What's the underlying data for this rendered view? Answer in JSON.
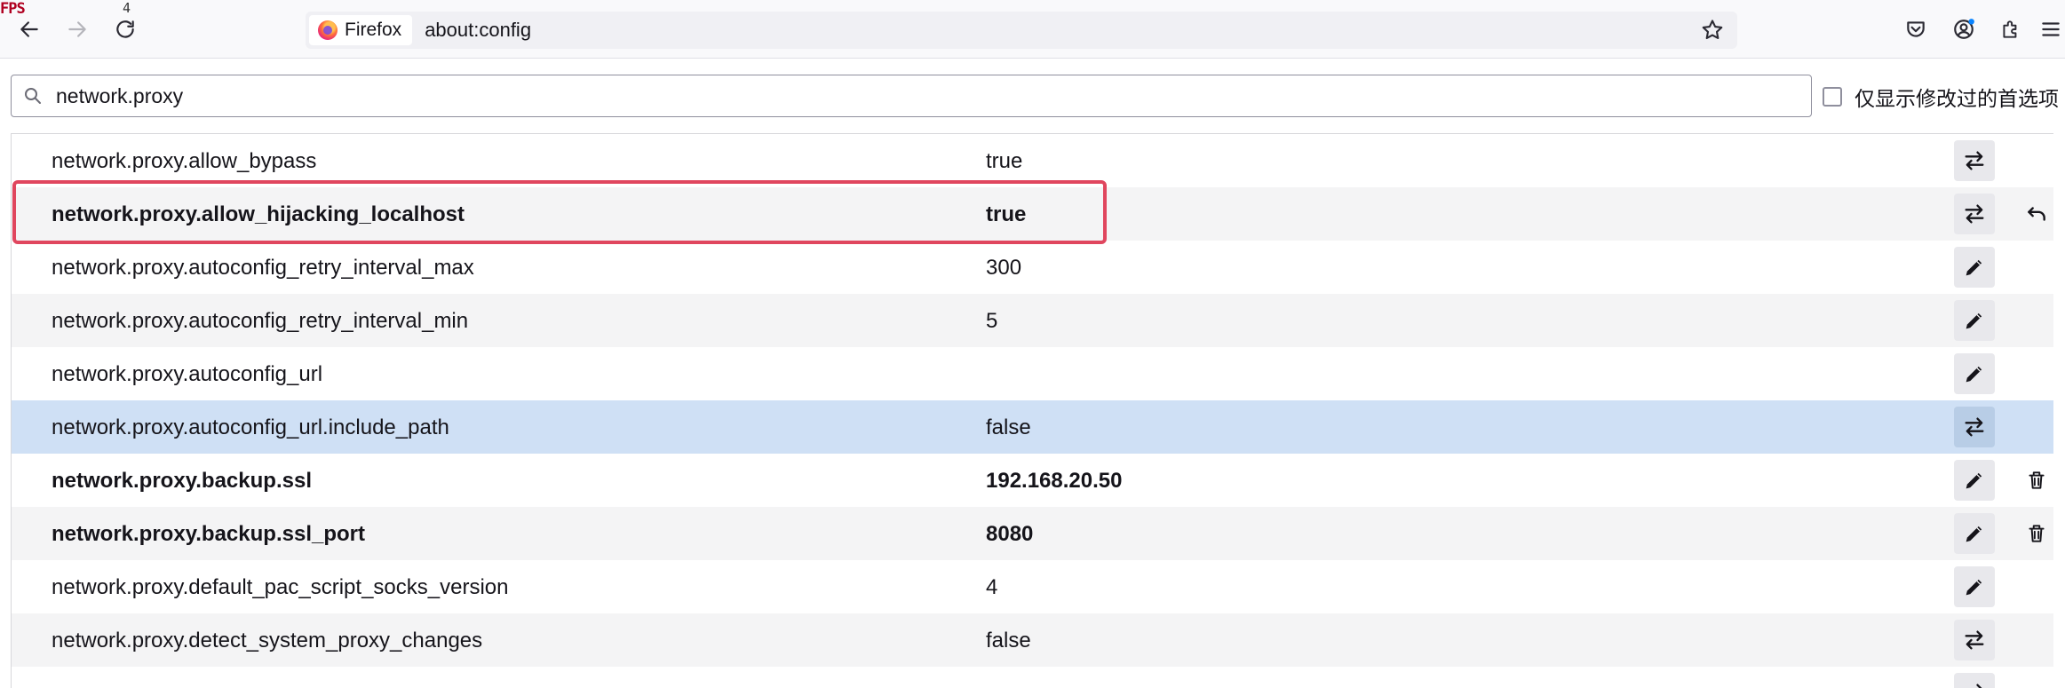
{
  "overlay": {
    "fps_label": "FPS",
    "fps_value": "4"
  },
  "browser": {
    "identity_label": "Firefox",
    "url": "about:config"
  },
  "search": {
    "value": "network.proxy"
  },
  "modified_only_label": "仅显示修改过的首选项",
  "prefs": [
    {
      "name": "network.proxy.allow_bypass",
      "value": "true",
      "modified": false,
      "action": "toggle",
      "extra": ""
    },
    {
      "name": "network.proxy.allow_hijacking_localhost",
      "value": "true",
      "modified": true,
      "action": "toggle",
      "extra": "reset"
    },
    {
      "name": "network.proxy.autoconfig_retry_interval_max",
      "value": "300",
      "modified": false,
      "action": "edit",
      "extra": ""
    },
    {
      "name": "network.proxy.autoconfig_retry_interval_min",
      "value": "5",
      "modified": false,
      "action": "edit",
      "extra": ""
    },
    {
      "name": "network.proxy.autoconfig_url",
      "value": "",
      "modified": false,
      "action": "edit",
      "extra": ""
    },
    {
      "name": "network.proxy.autoconfig_url.include_path",
      "value": "false",
      "modified": false,
      "action": "toggle",
      "extra": ""
    },
    {
      "name": "network.proxy.backup.ssl",
      "value": "192.168.20.50",
      "modified": true,
      "action": "edit",
      "extra": "delete"
    },
    {
      "name": "network.proxy.backup.ssl_port",
      "value": "8080",
      "modified": true,
      "action": "edit",
      "extra": "delete"
    },
    {
      "name": "network.proxy.default_pac_script_socks_version",
      "value": "4",
      "modified": false,
      "action": "edit",
      "extra": ""
    },
    {
      "name": "network.proxy.detect_system_proxy_changes",
      "value": "false",
      "modified": false,
      "action": "toggle",
      "extra": ""
    },
    {
      "name": "",
      "value": "",
      "modified": false,
      "action": "toggle",
      "extra": ""
    }
  ],
  "selected_row": 5,
  "highlighted_row": 1,
  "colors": {
    "highlight": "#e0465e",
    "selected_row": "#cfe0f5",
    "alt_row": "#f4f4f5"
  }
}
